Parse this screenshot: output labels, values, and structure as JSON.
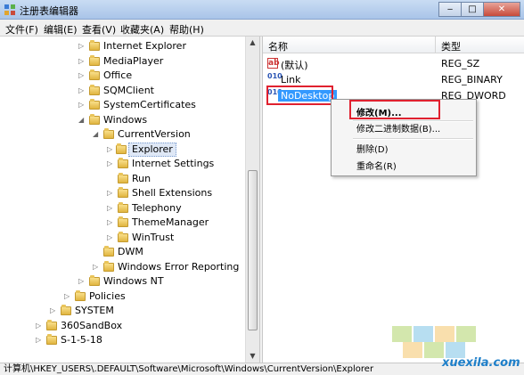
{
  "window": {
    "title": "注册表编辑器",
    "min": "‒",
    "max": "□",
    "close": "✕"
  },
  "menu": [
    "文件(F)",
    "编辑(E)",
    "查看(V)",
    "收藏夹(A)",
    "帮助(H)"
  ],
  "tree": [
    {
      "label": "Internet Explorer"
    },
    {
      "label": "MediaPlayer"
    },
    {
      "label": "Office"
    },
    {
      "label": "SQMClient"
    },
    {
      "label": "SystemCertificates"
    },
    {
      "label": "Windows"
    },
    {
      "label": "CurrentVersion"
    },
    {
      "label": "Explorer"
    },
    {
      "label": "Internet Settings"
    },
    {
      "label": "Run"
    },
    {
      "label": "Shell Extensions"
    },
    {
      "label": "Telephony"
    },
    {
      "label": "ThemeManager"
    },
    {
      "label": "WinTrust"
    },
    {
      "label": "DWM"
    },
    {
      "label": "Windows Error Reporting"
    },
    {
      "label": "Windows NT"
    },
    {
      "label": "Policies"
    },
    {
      "label": "SYSTEM"
    },
    {
      "label": "360SandBox"
    },
    {
      "label": "S-1-5-18"
    }
  ],
  "values": {
    "col_name": "名称",
    "col_type": "类型",
    "rows": [
      {
        "name": "(默认)",
        "type": "REG_SZ",
        "icon": "ab"
      },
      {
        "name": "Link",
        "type": "REG_BINARY",
        "icon": "010"
      },
      {
        "name": "NoDesktop",
        "type": "REG_DWORD",
        "icon": "010"
      }
    ]
  },
  "context_menu": [
    "修改(M)...",
    "修改二进制数据(B)...",
    "删除(D)",
    "重命名(R)"
  ],
  "status": "计算机\\HKEY_USERS\\.DEFAULT\\Software\\Microsoft\\Windows\\CurrentVersion\\Explorer",
  "watermark": "xuexila.com",
  "colors": {
    "highlight": "#e0212f",
    "selection": "#3399ff",
    "folder": "#e0b540"
  }
}
